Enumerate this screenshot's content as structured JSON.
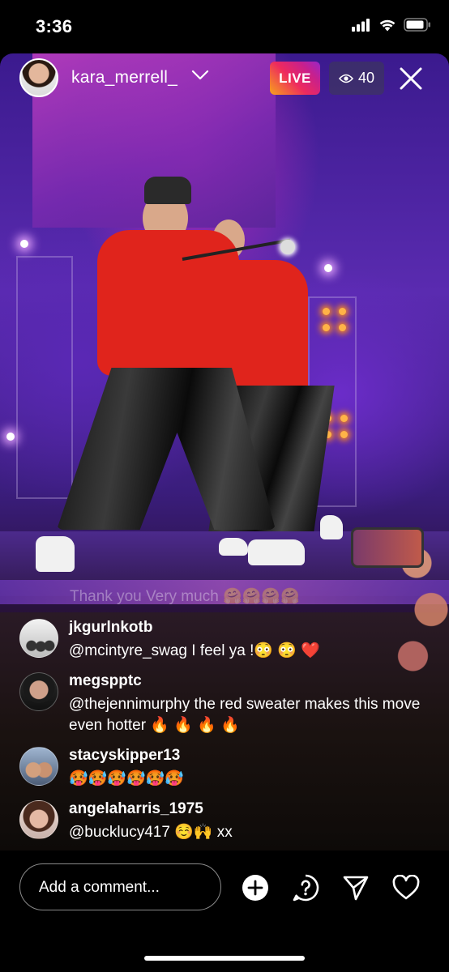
{
  "status_bar": {
    "time": "3:36",
    "icons": [
      "signal-icon",
      "wifi-icon",
      "battery-icon"
    ]
  },
  "live": {
    "host_username": "kara_merrell_",
    "live_label": "LIVE",
    "viewer_count": "40",
    "colors": {
      "live_gradient": [
        "#f7a31c",
        "#ee2a5e",
        "#c8208c",
        "#9a26c8"
      ]
    }
  },
  "comments": {
    "faded": "Thank you Very much 🤗🤗🤗🤗",
    "items": [
      {
        "username": "jkgurlnkotb",
        "text": "@mcintyre_swag I feel ya !😳 😳 ❤️"
      },
      {
        "username": "megspptc",
        "text": "@thejennimurphy the red sweater makes this move even hotter 🔥 🔥 🔥 🔥"
      },
      {
        "username": "stacyskipper13",
        "text": "🥵🥵🥵🥵🥵🥵"
      },
      {
        "username": "angelaharris_1975",
        "text": "@bucklucy417 ☺️🙌 xx"
      }
    ]
  },
  "bottom_bar": {
    "comment_placeholder": "Add a comment...",
    "actions": [
      "add-icon",
      "question-icon",
      "share-icon",
      "heart-icon"
    ]
  }
}
